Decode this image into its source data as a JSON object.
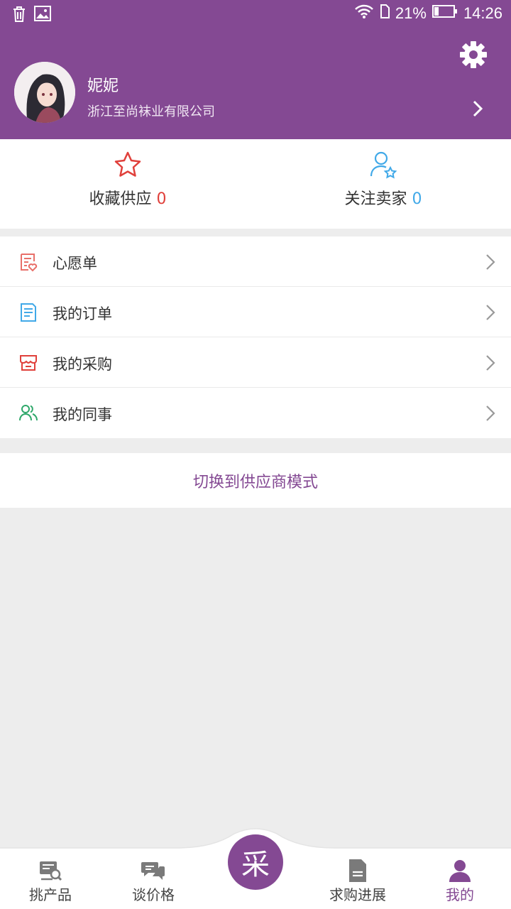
{
  "statusbar": {
    "battery": "21%",
    "time": "14:26",
    "icons": [
      "trash-icon",
      "image-icon",
      "wifi-icon",
      "sim-icon",
      "battery-icon"
    ]
  },
  "profile": {
    "name": "妮妮",
    "company": "浙江至尚袜业有限公司"
  },
  "stats": [
    {
      "label": "收藏供应",
      "count": "0",
      "icon": "star-icon",
      "color": "#e0403b"
    },
    {
      "label": "关注卖家",
      "count": "0",
      "icon": "user-star-icon",
      "color": "#41a9e8"
    }
  ],
  "menu": [
    {
      "label": "心愿单",
      "icon": "wishlist-icon"
    },
    {
      "label": "我的订单",
      "icon": "order-icon"
    },
    {
      "label": "我的采购",
      "icon": "shop-icon"
    },
    {
      "label": "我的同事",
      "icon": "colleagues-icon"
    }
  ],
  "switch_label": "切换到供应商模式",
  "tabs": [
    {
      "label": "挑产品",
      "icon": "product-search-icon"
    },
    {
      "label": "谈价格",
      "icon": "chat-icon"
    },
    {
      "label": "采",
      "icon": "center-action"
    },
    {
      "label": "求购进展",
      "icon": "document-icon"
    },
    {
      "label": "我的",
      "icon": "profile-icon"
    }
  ],
  "colors": {
    "brand": "#844993",
    "accent_red": "#e0403b",
    "accent_blue": "#41a9e8",
    "accent_green": "#2fa86a"
  }
}
